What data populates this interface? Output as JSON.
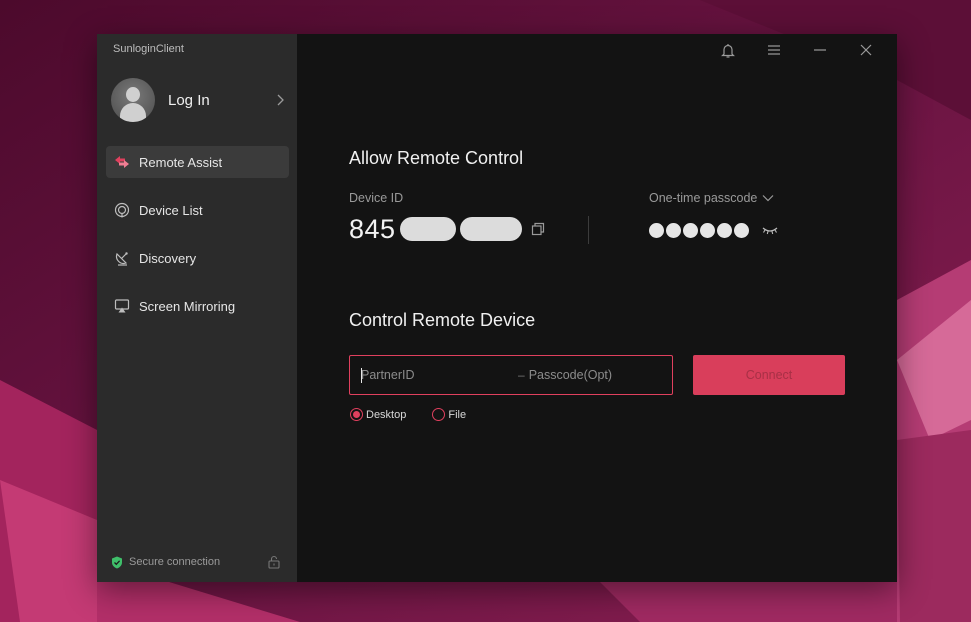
{
  "app": {
    "title": "SunloginClient"
  },
  "sidebar": {
    "login_label": "Log In",
    "items": [
      {
        "label": "Remote Assist",
        "icon": "remote-assist-icon",
        "active": true
      },
      {
        "label": "Device List",
        "icon": "device-list-icon",
        "active": false
      },
      {
        "label": "Discovery",
        "icon": "discovery-icon",
        "active": false
      },
      {
        "label": "Screen Mirroring",
        "icon": "screen-mirroring-icon",
        "active": false
      }
    ],
    "footer": {
      "secure_label": "Secure connection",
      "shield_icon": "shield-check-icon",
      "lock_icon": "unlock-icon"
    }
  },
  "titlebar": {
    "icons": [
      "bell-icon",
      "menu-icon",
      "minimize-icon",
      "close-icon"
    ]
  },
  "allow": {
    "title": "Allow Remote Control",
    "device_id_label": "Device ID",
    "device_id_visible": "845",
    "passcode_label": "One-time passcode",
    "passcode_mask_count": 6
  },
  "control": {
    "title": "Control Remote Device",
    "partner_placeholder": "PartnerID",
    "separator": "–",
    "passcode_placeholder": "Passcode(Opt)",
    "connect_label": "Connect",
    "modes": [
      {
        "label": "Desktop",
        "selected": true
      },
      {
        "label": "File",
        "selected": false
      }
    ]
  },
  "colors": {
    "accent": "#e0405e",
    "button": "#d93e5b",
    "sidebar_bg": "#2b2b2b",
    "main_bg": "#131313"
  }
}
